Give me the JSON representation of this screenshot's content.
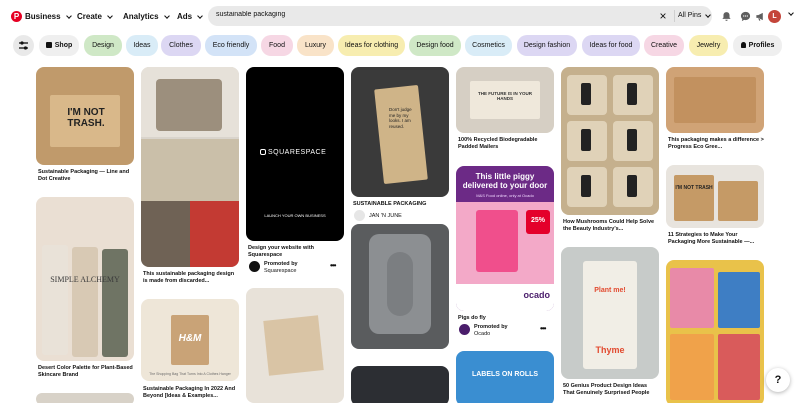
{
  "header": {
    "logo_letter": "P",
    "account_label": "Business",
    "nav": [
      "Create",
      "Analytics",
      "Ads"
    ],
    "search_value": "sustainable packaging",
    "scope_label": "All Pins",
    "avatar_letter": "L"
  },
  "filters": {
    "shop_label": "Shop",
    "chips": [
      "Design",
      "Ideas",
      "Clothes",
      "Eco friendly",
      "Food",
      "Luxury",
      "Ideas for clothing",
      "Design food",
      "Cosmetics",
      "Design fashion",
      "Ideas for food",
      "Creative",
      "Jewelry"
    ],
    "profiles_label": "Profiles",
    "colors": [
      "#cfe8c6",
      "#d9ecf7",
      "#dcd7f3",
      "#d3e3f7",
      "#f6d7e4",
      "#f9e3c8",
      "#f7edb0",
      "#cfe8c6",
      "#d9ecf7",
      "#dcd7f3",
      "#dcd7f3",
      "#f6d7e4",
      "#f7edb0"
    ]
  },
  "pins": {
    "p1_title": "Sustainable Packaging — Line and Dot Creative",
    "p1_box_text": "I'M NOT TRASH.",
    "p2_title": "Desert Color Palette for Plant-Based Skincare Brand",
    "p2_brand": "SIMPLE ALCHEMY",
    "p3_title": "This sustainable packaging design is made from discarded...",
    "p4_brand": "SQUARESPACE",
    "p4_cta": "LAUNCH YOUR OWN BUSINESS",
    "p4_title": "Design your website with Squarespace",
    "p4_promoted": "Promoted by",
    "p4_promoter": "Squarespace",
    "p5_title": "Sustainable Packaging In 2022 And Beyond [Ideas & Examples...",
    "p5_brand": "H&M",
    "p5_note": "The Shopping Bag That Turns Into A Clothes Hanger",
    "p6_bag_text": "Don't judge me by my looks. I am reused.",
    "p6_title": "SUSTAINABLE PACKAGING",
    "p6_author": "JAN 'N JUNE",
    "p7_title": "100% Recycled Biodegradable Padded Mailers",
    "p7_bag_text": "THE FUTURE IS IN YOUR HANDS",
    "p8_headline": "This little piggy delivered to your door",
    "p8_sub": "M&S Food online, only at Ocado",
    "p8_badge": "25%",
    "p8_brand": "ocado",
    "p8_title": "Pigs do fly",
    "p8_promoted": "Promoted by",
    "p8_promoter": "Ocado",
    "p9_banner": "LABELS ON ROLLS",
    "p10_title": "How Mushrooms Could Help Solve the Beauty Industry's...",
    "p11_tag_text": "Plant me!",
    "p11_tag_name": "Thyme",
    "p11_title": "50 Genius Product Design Ideas That Genuinely Surprised People",
    "p12_title": "This packaging makes a difference > Progress Eco Gree...",
    "p13_box_text": "I'M NOT TRASH",
    "p13_title": "11 Strategies to Make Your Packaging More Sustainable —...",
    "help_label": "?"
  }
}
